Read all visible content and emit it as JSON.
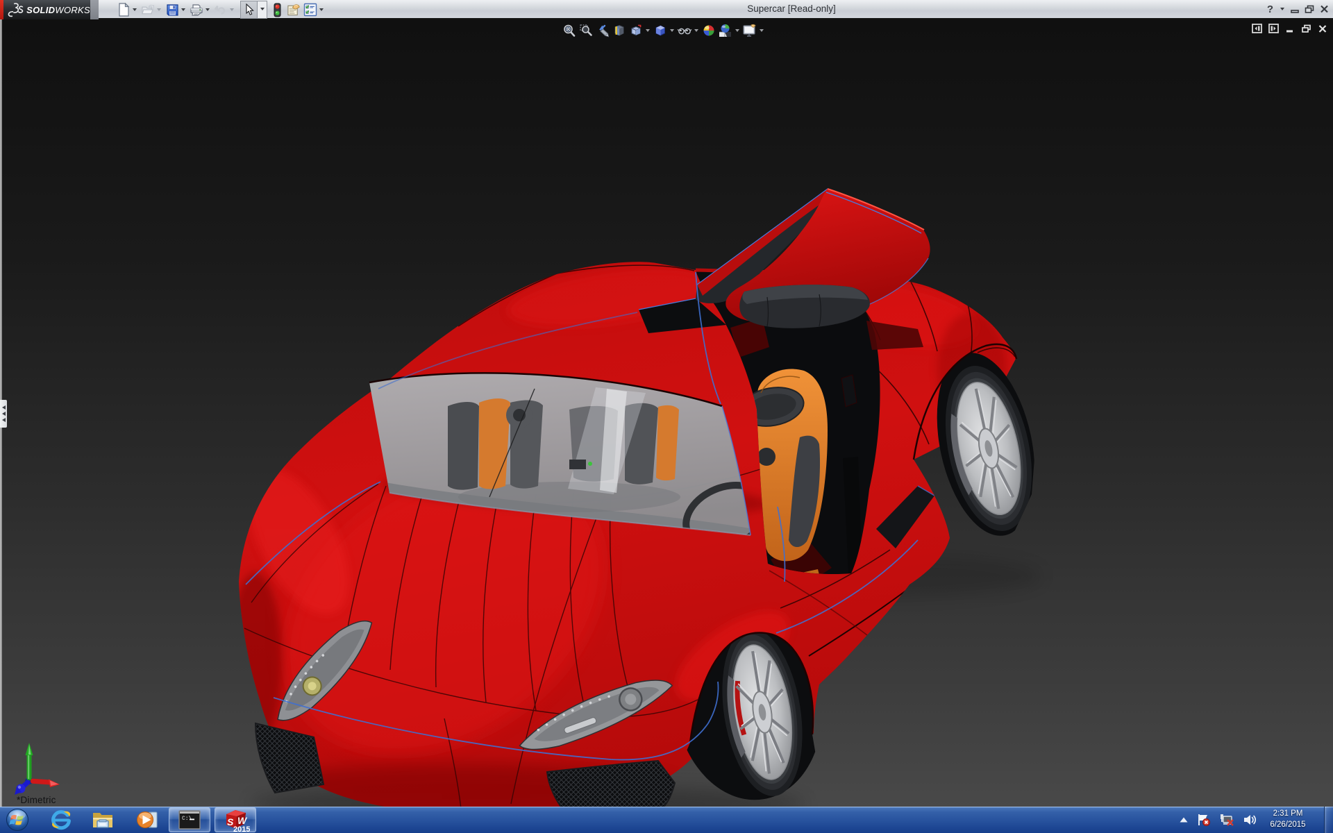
{
  "window": {
    "title": "Supercar [Read-only]",
    "help_glyph": "?",
    "controls": [
      "help-button",
      "help-dropdown",
      "minimize-button",
      "restore-button",
      "close-button"
    ]
  },
  "logo": {
    "brand_prefix": "SOLID",
    "brand_suffix": "WORKS",
    "mark": "3DS-glyph"
  },
  "main_toolbar": {
    "items": [
      {
        "icon": "new-document-icon",
        "has_dropdown": true,
        "enabled": true
      },
      {
        "icon": "open-icon",
        "has_dropdown": true,
        "enabled": false
      },
      {
        "icon": "save-icon",
        "has_dropdown": true,
        "enabled": true
      },
      {
        "icon": "print-icon",
        "has_dropdown": true,
        "enabled": true
      },
      {
        "icon": "undo-icon",
        "has_dropdown": true,
        "enabled": false
      },
      {
        "icon": "select-cursor-icon",
        "has_dropdown": true,
        "enabled": true,
        "pressed": true
      },
      {
        "icon": "traffic-light-icon",
        "has_dropdown": false,
        "enabled": true
      },
      {
        "icon": "comment-note-icon",
        "has_dropdown": false,
        "enabled": true
      },
      {
        "icon": "options-checklist-icon",
        "has_dropdown": true,
        "enabled": true
      }
    ]
  },
  "heads_up_toolbar": {
    "items": [
      {
        "icon": "zoom-fit-icon",
        "has_dropdown": false
      },
      {
        "icon": "zoom-area-icon",
        "has_dropdown": false
      },
      {
        "icon": "previous-view-icon",
        "has_dropdown": false
      },
      {
        "icon": "section-view-icon",
        "has_dropdown": false
      },
      {
        "icon": "view-orientation-icon",
        "has_dropdown": true
      },
      {
        "icon": "display-style-icon",
        "has_dropdown": true
      },
      {
        "icon": "hide-show-items-icon",
        "has_dropdown": true
      },
      {
        "icon": "edit-appearance-icon",
        "has_dropdown": false
      },
      {
        "icon": "apply-scene-icon",
        "has_dropdown": true
      },
      {
        "icon": "view-settings-icon",
        "has_dropdown": true
      }
    ]
  },
  "viewport": {
    "view_label": "*Dimetric",
    "background_top": "#131313",
    "background_bottom": "#4a4a4a",
    "model_name": "Supercar",
    "car_body_color": "#c50d0d",
    "car_accent_line_color": "#3d6cd0",
    "seat_color": "#e08030",
    "glass_color": "#b5b7ba",
    "document_controls": [
      "pane-left-icon",
      "pane-right-icon",
      "doc-minimize-button",
      "doc-restore-button",
      "doc-close-button"
    ],
    "feature_manager_tab": "collapsed",
    "triad_axes": [
      "x-red",
      "y-green",
      "z-blue"
    ]
  },
  "taskbar": {
    "items": [
      {
        "name": "start",
        "icon": "windows-start-orb"
      },
      {
        "name": "internet-explorer",
        "icon": "ie-icon"
      },
      {
        "name": "windows-explorer",
        "icon": "folder-icon"
      },
      {
        "name": "media-player",
        "icon": "wmp-icon"
      },
      {
        "name": "command-prompt",
        "icon": "cmd-icon",
        "active": true,
        "label": "C:\\"
      },
      {
        "name": "solidworks-2015",
        "icon": "sw-cube-icon",
        "active": true,
        "badge": "2015",
        "letters": "SW"
      }
    ],
    "tray": {
      "icons": [
        "show-hidden-icon",
        "action-center-flag-icon",
        "network-error-icon",
        "volume-icon"
      ],
      "time": "2:31 PM",
      "date": "6/26/2015"
    },
    "cmd_prompt": "C:\\",
    "sw_letter_s": "S",
    "sw_letter_w": "W",
    "sw_badge": "2015"
  }
}
